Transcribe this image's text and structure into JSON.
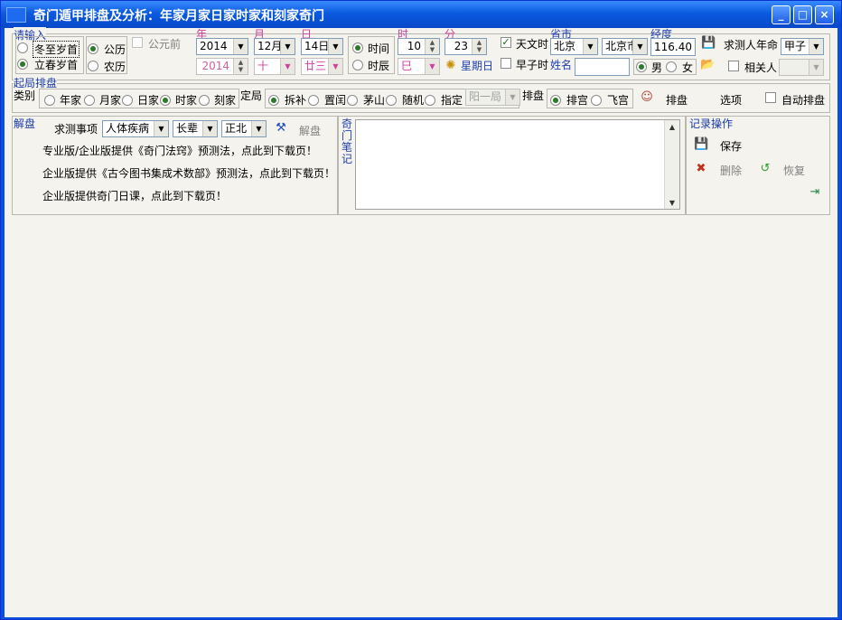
{
  "window": {
    "title": "奇门遁甲排盘及分析：年家月家日家时家和刻家奇门",
    "minimize": "_",
    "maximize": "□",
    "close": "×"
  },
  "input": {
    "group_title": "请输入",
    "dongzhi": "冬至岁首",
    "lichun": "立春岁首",
    "gongli": "公历",
    "nongli": "农历",
    "gongyuanqian": "公元前",
    "labels": {
      "year": "年",
      "month": "月",
      "day": "日",
      "hour": "时",
      "minute": "分",
      "province": "省市",
      "longitude": "经度",
      "name": "姓名"
    },
    "year": "2014",
    "month": "12月",
    "day": "14日",
    "lunar_year": "2014",
    "lunar_month": "十",
    "lunar_day": "廿三",
    "time_radio": "时间",
    "chen_radio": "时辰",
    "hour": "10",
    "minute": "23",
    "chen": "巳",
    "weekday": "星期日",
    "tianwen": "天文时",
    "zaozi": "早子时",
    "province": "北京",
    "city": "北京市",
    "longitude": "116.40",
    "seeker_year_label": "求测人年命",
    "seeker_year": "甲子",
    "male": "男",
    "female": "女",
    "related": "相关人",
    "related_value": ""
  },
  "layout": {
    "group_title": "起局排盘",
    "type_label": "类别",
    "types": [
      "年家",
      "月家",
      "日家",
      "时家",
      "刻家"
    ],
    "dingju_label": "定局",
    "dingju": [
      "拆补",
      "置闰",
      "茅山",
      "随机",
      "指定"
    ],
    "specified": "阳一局",
    "paipan_label": "排盘",
    "paipan": [
      "排宫",
      "飞宫"
    ],
    "paipan_button": "排盘",
    "options": "选项",
    "auto": "自动排盘"
  },
  "analysis": {
    "group_title": "解盘",
    "matter_label": "求测事项",
    "matter": "人体疾病",
    "relation": "长辈",
    "direction": "正北",
    "solve": "解盘",
    "lines": [
      "专业版/企业版提供《奇门法窍》预测法，点此到下载页！",
      "企业版提供《古今图书集成术数部》预测法，点此到下载页！",
      "企业版提供奇门日课，点此到下载页！"
    ]
  },
  "notes": {
    "label": "奇门笔记",
    "text": ""
  },
  "record": {
    "group_title": "记录操作",
    "save": "保存",
    "delete": "删除",
    "restore": "恢复"
  }
}
